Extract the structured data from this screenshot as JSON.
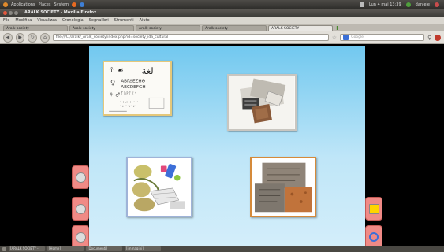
{
  "system_panel": {
    "applications": "Applications",
    "places": "Places",
    "system": "System",
    "clock": "Lun 4 mai 13:39",
    "user": "daniele"
  },
  "window": {
    "title": "ARALK SOCIETY - Mozilla Firefox"
  },
  "menu": {
    "items": [
      "File",
      "Modifica",
      "Visualizza",
      "Cronologia",
      "Segnalibri",
      "Strumenti",
      "Aiuto"
    ]
  },
  "tabs": {
    "items": [
      "Aralk society",
      "Aralk society",
      "Aralk society",
      "Aralk society",
      "ARALK SOCIETY"
    ],
    "active_index": 4
  },
  "nav": {
    "url": "file:///C:/aralk/_Aralk_society/index.php?id=society_ida_cultural",
    "search_placeholder": "Google"
  },
  "colors": {
    "panel_top": "#71c8ef",
    "panel_bottom": "#d4eefa",
    "side_button": "#f08a86",
    "card_border_cream": "#e5c87a",
    "card_border_gray": "#c9c6c0",
    "card_border_blue": "#9fb3d8",
    "card_border_orange": "#d58a3a"
  },
  "cards": {
    "c1": "writing-symbols-image",
    "c2": "typewriter-documents-image",
    "c3": "science-collage-image",
    "c4": "stone-tablets-image"
  },
  "taskbar": {
    "items": [
      "[ARALK SOCIETY -]",
      "[Home]",
      "[Documenti]",
      "[immagini]"
    ]
  }
}
